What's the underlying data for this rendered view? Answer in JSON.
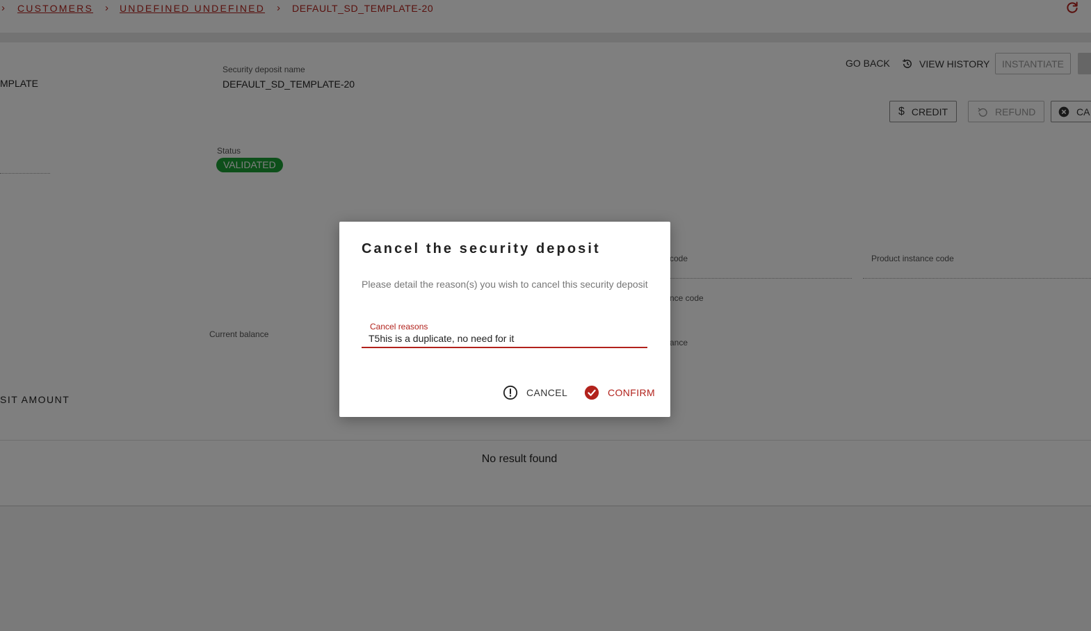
{
  "breadcrumb": {
    "items": [
      "CUSTOMERS",
      "UNDEFINED UNDEFINED"
    ],
    "current": "DEFAULT_SD_TEMPLATE-20"
  },
  "header_actions": {
    "go_back": "GO BACK",
    "view_history": "VIEW HISTORY",
    "instantiate": "INSTANTIATE",
    "credit": "CREDIT",
    "refund": "REFUND",
    "cancel_partial": "CA"
  },
  "details": {
    "template_fragment": "MPLATE",
    "sd_name_label": "Security deposit name",
    "sd_name_value": "DEFAULT_SD_TEMPLATE-20",
    "status_label": "Status",
    "status_value": "VALIDATED",
    "current_balance_label": "Current balance",
    "code_fragment": "code",
    "product_instance_code_label": "Product instance code",
    "nce_code_fragment": "nce code",
    "ance_fragment": "ance"
  },
  "section": {
    "title_fragment": "SIT AMOUNT",
    "empty_text": "No result found"
  },
  "dialog": {
    "title": "Cancel the security deposit",
    "description": "Please detail the reason(s) you wish to cancel this security deposit",
    "field_label": "Cancel reasons",
    "field_value": "T5his is a duplicate, no need for it",
    "cancel_label": "CANCEL",
    "confirm_label": "CONFIRM"
  },
  "colors": {
    "accent": "#b2221c",
    "status_green": "#1a9e35"
  }
}
